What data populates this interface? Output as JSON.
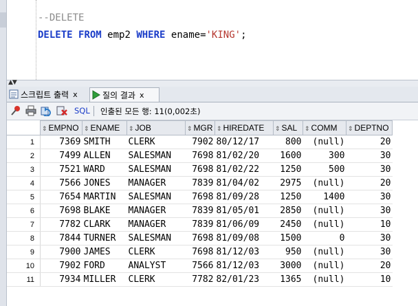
{
  "editor": {
    "comment_line": "--DELETE",
    "kw_delete": "DELETE",
    "kw_from": "FROM",
    "table_name": "emp2",
    "kw_where": "WHERE",
    "condition_col": "ename=",
    "condition_val": "'KING'",
    "terminator": ";"
  },
  "tabs": [
    {
      "label": "스크립트 출력",
      "close": "x"
    },
    {
      "label": "질의 결과",
      "close": "x"
    }
  ],
  "toolbar": {
    "sql_label": "SQL",
    "status": "인출된 모든 행: 11(0,002초)"
  },
  "icons": [
    "pin-icon",
    "print-icon",
    "refresh-icon",
    "delete-sql-icon"
  ],
  "result_grid": {
    "columns": [
      "EMPNO",
      "ENAME",
      "JOB",
      "MGR",
      "HIREDATE",
      "SAL",
      "COMM",
      "DEPTNO"
    ],
    "rows": [
      [
        "1",
        "7369",
        "SMITH",
        "CLERK",
        "7902",
        "80/12/17",
        "800",
        "(null)",
        "20"
      ],
      [
        "2",
        "7499",
        "ALLEN",
        "SALESMAN",
        "7698",
        "81/02/20",
        "1600",
        "300",
        "30"
      ],
      [
        "3",
        "7521",
        "WARD",
        "SALESMAN",
        "7698",
        "81/02/22",
        "1250",
        "500",
        "30"
      ],
      [
        "4",
        "7566",
        "JONES",
        "MANAGER",
        "7839",
        "81/04/02",
        "2975",
        "(null)",
        "20"
      ],
      [
        "5",
        "7654",
        "MARTIN",
        "SALESMAN",
        "7698",
        "81/09/28",
        "1250",
        "1400",
        "30"
      ],
      [
        "6",
        "7698",
        "BLAKE",
        "MANAGER",
        "7839",
        "81/05/01",
        "2850",
        "(null)",
        "30"
      ],
      [
        "7",
        "7782",
        "CLARK",
        "MANAGER",
        "7839",
        "81/06/09",
        "2450",
        "(null)",
        "10"
      ],
      [
        "8",
        "7844",
        "TURNER",
        "SALESMAN",
        "7698",
        "81/09/08",
        "1500",
        "0",
        "30"
      ],
      [
        "9",
        "7900",
        "JAMES",
        "CLERK",
        "7698",
        "81/12/03",
        "950",
        "(null)",
        "30"
      ],
      [
        "10",
        "7902",
        "FORD",
        "ANALYST",
        "7566",
        "81/12/03",
        "3000",
        "(null)",
        "20"
      ],
      [
        "11",
        "7934",
        "MILLER",
        "CLERK",
        "7782",
        "82/01/23",
        "1365",
        "(null)",
        "10"
      ]
    ]
  }
}
